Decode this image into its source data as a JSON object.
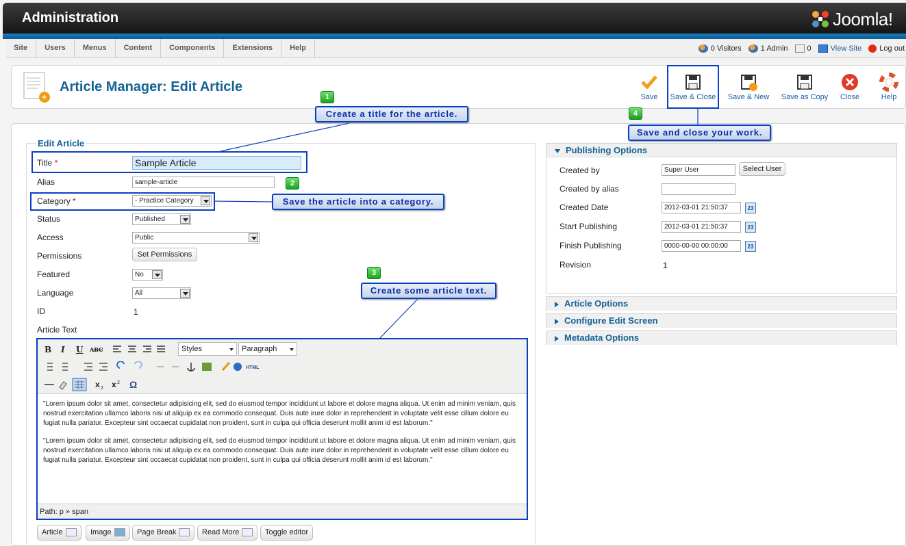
{
  "header": {
    "title": "Administration",
    "logo_text": "Joomla!"
  },
  "menu": [
    "Site",
    "Users",
    "Menus",
    "Content",
    "Components",
    "Extensions",
    "Help"
  ],
  "status": {
    "visitors": "0 Visitors",
    "admin": "1 Admin",
    "messages": "0",
    "view_site": "View Site",
    "logout": "Log out"
  },
  "page": {
    "title": "Article Manager: Edit Article"
  },
  "toolbar": {
    "save": "Save",
    "save_close": "Save & Close",
    "save_new": "Save & New",
    "save_copy": "Save as Copy",
    "close": "Close",
    "help": "Help"
  },
  "form": {
    "legend": "Edit Article",
    "title_label": "Title",
    "title_value": "Sample Article",
    "alias_label": "Alias",
    "alias_value": "sample-article",
    "category_label": "Category",
    "category_value": "- Practice Category",
    "status_label": "Status",
    "status_value": "Published",
    "access_label": "Access",
    "access_value": "Public",
    "permissions_label": "Permissions",
    "permissions_button": "Set Permissions",
    "featured_label": "Featured",
    "featured_value": "No",
    "language_label": "Language",
    "language_value": "All",
    "id_label": "ID",
    "id_value": "1",
    "article_text_label": "Article Text"
  },
  "editor": {
    "styles": "Styles",
    "format": "Paragraph",
    "paragraphs": [
      "\"Lorem ipsum dolor sit amet, consectetur adipisicing elit, sed do eiusmod tempor incididunt ut labore et dolore magna aliqua. Ut enim ad minim veniam, quis nostrud exercitation ullamco laboris nisi ut aliquip ex ea commodo consequat. Duis aute irure dolor in reprehenderit in voluptate velit esse cillum dolore eu fugiat nulla pariatur. Excepteur sint occaecat cupidatat non proident, sunt in culpa qui officia deserunt mollit anim id est laborum.\"",
      "\"Lorem ipsum dolor sit amet, consectetur adipisicing elit, sed do eiusmod tempor incididunt ut labore et dolore magna aliqua. Ut enim ad minim veniam, quis nostrud exercitation ullamco laboris nisi ut aliquip ex ea commodo consequat. Duis aute irure dolor in reprehenderit in voluptate velit esse cillum dolore eu fugiat nulla pariatur. Excepteur sint occaecat cupidatat non proident, sunt in culpa qui officia deserunt mollit anim id est laborum.\""
    ],
    "path": "Path: p » span"
  },
  "editor_buttons": [
    "Article",
    "Image",
    "Page Break",
    "Read More",
    "Toggle editor"
  ],
  "publishing": {
    "header": "Publishing Options",
    "created_by_label": "Created by",
    "created_by_value": "Super User",
    "select_user": "Select User",
    "created_by_alias_label": "Created by alias",
    "created_date_label": "Created Date",
    "created_date_value": "2012-03-01 21:50:37",
    "start_label": "Start Publishing",
    "start_value": "2012-03-01 21:50:37",
    "finish_label": "Finish Publishing",
    "finish_value": "0000-00-00 00:00:00",
    "revision_label": "Revision",
    "revision_value": "1",
    "cal_day": "23"
  },
  "collapsed_panels": [
    "Article Options",
    "Configure Edit Screen",
    "Metadata Options"
  ],
  "callouts": {
    "c1": {
      "num": "1",
      "text": "Create a title for the article."
    },
    "c2": {
      "num": "2",
      "text": "Save the article into a category."
    },
    "c3": {
      "num": "3",
      "text": "Create some article text."
    },
    "c4": {
      "num": "4",
      "text": "Save and close your work."
    }
  },
  "icons": {
    "save": "check-icon",
    "save_close": "floppy-icon",
    "save_new": "floppy-plus-icon",
    "save_copy": "floppy-copy-icon",
    "close": "close-circle-icon",
    "help": "lifebuoy-icon"
  }
}
